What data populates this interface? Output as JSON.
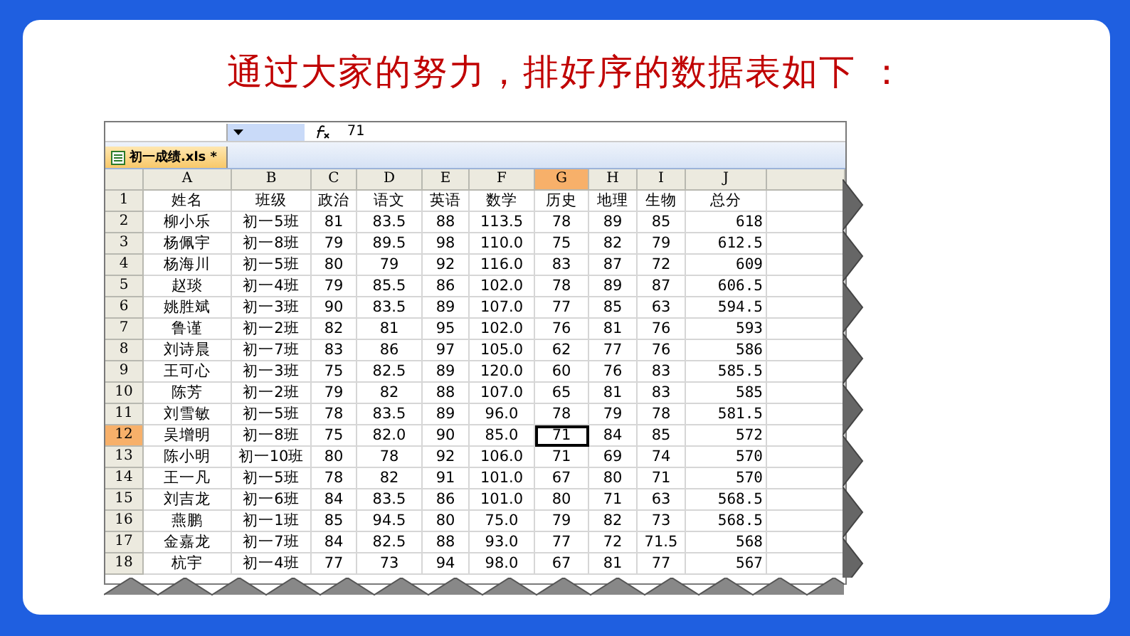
{
  "title": "通过大家的努力，排好序的数据表如下 ：",
  "sheet": {
    "formula_value": "71",
    "file_tab": "初一成绩.xls *",
    "columns": [
      {
        "label": "A",
        "selected": false
      },
      {
        "label": "B",
        "selected": false
      },
      {
        "label": "C",
        "selected": false
      },
      {
        "label": "D",
        "selected": false
      },
      {
        "label": "E",
        "selected": false
      },
      {
        "label": "F",
        "selected": false
      },
      {
        "label": "G",
        "selected": true
      },
      {
        "label": "H",
        "selected": false
      },
      {
        "label": "I",
        "selected": false
      },
      {
        "label": "J",
        "selected": false
      }
    ],
    "rows": [
      {
        "number": "1",
        "selected": false,
        "cells": [
          "姓名",
          "班级",
          "政治",
          "语文",
          "英语",
          "数学",
          "历史",
          "地理",
          "生物",
          "总分"
        ]
      },
      {
        "number": "2",
        "selected": false,
        "cells": [
          "柳小乐",
          "初一5班",
          "81",
          "83.5",
          "88",
          "113.5",
          "78",
          "89",
          "85",
          "618"
        ]
      },
      {
        "number": "3",
        "selected": false,
        "cells": [
          "杨佩宇",
          "初一8班",
          "79",
          "89.5",
          "98",
          "110.0",
          "75",
          "82",
          "79",
          "612.5"
        ]
      },
      {
        "number": "4",
        "selected": false,
        "cells": [
          "杨海川",
          "初一5班",
          "80",
          "79",
          "92",
          "116.0",
          "83",
          "87",
          "72",
          "609"
        ]
      },
      {
        "number": "5",
        "selected": false,
        "cells": [
          "赵琰",
          "初一4班",
          "79",
          "85.5",
          "86",
          "102.0",
          "78",
          "89",
          "87",
          "606.5"
        ]
      },
      {
        "number": "6",
        "selected": false,
        "cells": [
          "姚胜斌",
          "初一3班",
          "90",
          "83.5",
          "89",
          "107.0",
          "77",
          "85",
          "63",
          "594.5"
        ]
      },
      {
        "number": "7",
        "selected": false,
        "cells": [
          "鲁谨",
          "初一2班",
          "82",
          "81",
          "95",
          "102.0",
          "76",
          "81",
          "76",
          "593"
        ]
      },
      {
        "number": "8",
        "selected": false,
        "cells": [
          "刘诗晨",
          "初一7班",
          "83",
          "86",
          "97",
          "105.0",
          "62",
          "77",
          "76",
          "586"
        ]
      },
      {
        "number": "9",
        "selected": false,
        "cells": [
          "王可心",
          "初一3班",
          "75",
          "82.5",
          "89",
          "120.0",
          "60",
          "76",
          "83",
          "585.5"
        ]
      },
      {
        "number": "10",
        "selected": false,
        "cells": [
          "陈芳",
          "初一2班",
          "79",
          "82",
          "88",
          "107.0",
          "65",
          "81",
          "83",
          "585"
        ]
      },
      {
        "number": "11",
        "selected": false,
        "cells": [
          "刘雪敏",
          "初一5班",
          "78",
          "83.5",
          "89",
          "96.0",
          "78",
          "79",
          "78",
          "581.5"
        ]
      },
      {
        "number": "12",
        "selected": true,
        "cells": [
          "吴增明",
          "初一8班",
          "75",
          "82.0",
          "90",
          "85.0",
          "71",
          "84",
          "85",
          "572"
        ]
      },
      {
        "number": "13",
        "selected": false,
        "cells": [
          "陈小明",
          "初一10班",
          "80",
          "78",
          "92",
          "106.0",
          "71",
          "69",
          "74",
          "570"
        ]
      },
      {
        "number": "14",
        "selected": false,
        "cells": [
          "王一凡",
          "初一5班",
          "78",
          "82",
          "91",
          "101.0",
          "67",
          "80",
          "71",
          "570"
        ]
      },
      {
        "number": "15",
        "selected": false,
        "cells": [
          "刘吉龙",
          "初一6班",
          "84",
          "83.5",
          "86",
          "101.0",
          "80",
          "71",
          "63",
          "568.5"
        ]
      },
      {
        "number": "16",
        "selected": false,
        "cells": [
          "燕鹏",
          "初一1班",
          "85",
          "94.5",
          "80",
          "75.0",
          "79",
          "82",
          "73",
          "568.5"
        ]
      },
      {
        "number": "17",
        "selected": false,
        "cells": [
          "金嘉龙",
          "初一7班",
          "84",
          "82.5",
          "88",
          "93.0",
          "77",
          "72",
          "71.5",
          "568"
        ]
      },
      {
        "number": "18",
        "selected": false,
        "cells": [
          "杭宇",
          "初一4班",
          "77",
          "73",
          "94",
          "98.0",
          "67",
          "81",
          "77",
          "567"
        ]
      }
    ]
  }
}
